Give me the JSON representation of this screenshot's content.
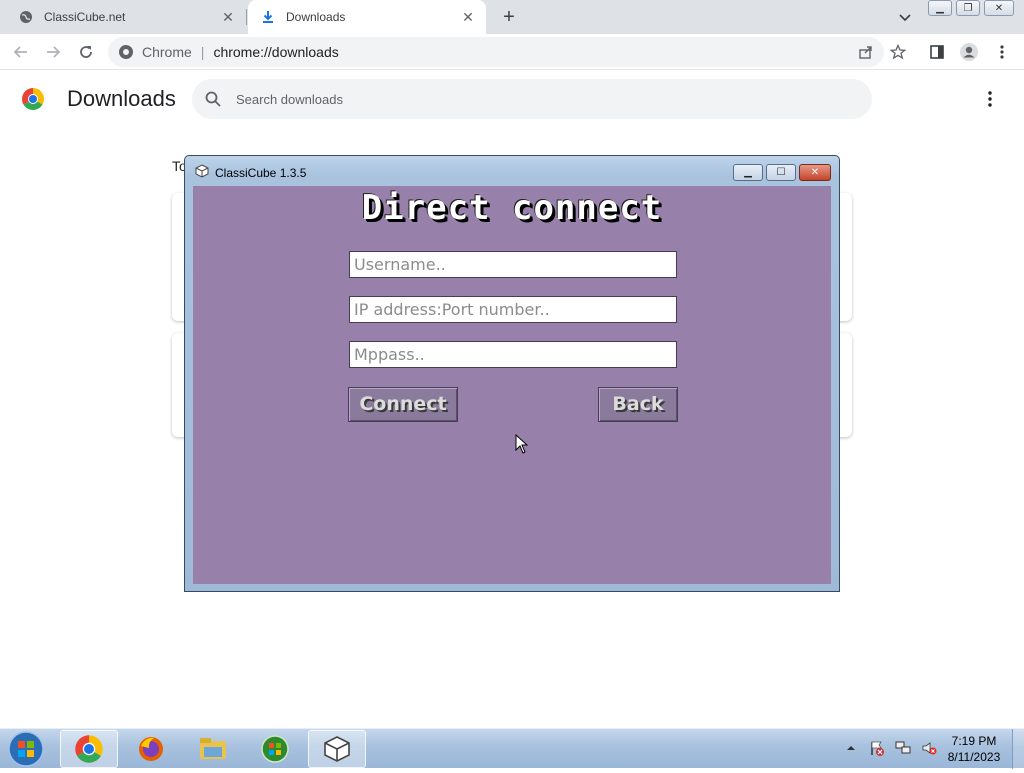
{
  "browser": {
    "tabs": [
      {
        "label": "ClassiCube.net",
        "icon": "globe-icon",
        "active": false
      },
      {
        "label": "Downloads",
        "icon": "download-icon",
        "active": true
      }
    ],
    "omnibox": {
      "chip": "Chrome",
      "url": "chrome://downloads"
    }
  },
  "downloads_page": {
    "title": "Downloads",
    "search_placeholder": "Search downloads",
    "section_label": "To"
  },
  "classicube": {
    "window_title": "ClassiCube 1.3.5",
    "heading": "Direct connect",
    "fields": [
      {
        "placeholder": "Username.."
      },
      {
        "placeholder": "IP address:Port number.."
      },
      {
        "placeholder": "Mppass.."
      }
    ],
    "connect_label": "Connect",
    "back_label": "Back",
    "background_color": "#9780a9"
  },
  "taskbar": {
    "time": "7:19 PM",
    "date": "8/11/2023"
  }
}
